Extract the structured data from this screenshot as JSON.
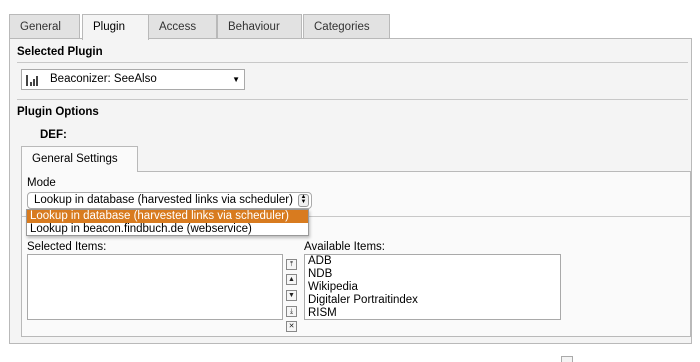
{
  "tabs": [
    {
      "label": "General",
      "active": false
    },
    {
      "label": "Plugin",
      "active": true
    },
    {
      "label": "Access",
      "active": false
    },
    {
      "label": "Behaviour",
      "active": false
    },
    {
      "label": "Categories",
      "active": false
    }
  ],
  "plugin": {
    "section_title": "Selected Plugin",
    "selected": "Beaconizer: SeeAlso",
    "icon": "beacon-icon"
  },
  "options": {
    "section_title": "Plugin Options",
    "def_label": "DEF:",
    "inner_tab": "General Settings",
    "mode_label": "Mode",
    "mode_value": "Lookup in database (harvested links via scheduler)",
    "mode_options": [
      "Lookup in database (harvested links via scheduler)",
      "Lookup in beacon.findbuch.de (webservice)"
    ],
    "selected_items_label": "Selected Items:",
    "available_items_label": "Available Items:",
    "selected_items": [],
    "available_items": [
      "ADB",
      "NDB",
      "Wikipedia",
      "Digitaler Portraitindex",
      "RISM"
    ]
  },
  "colors": {
    "accent": "#d87b1f",
    "panel_bg": "#f4f4f4",
    "tab_bg": "#e2e2e2"
  }
}
